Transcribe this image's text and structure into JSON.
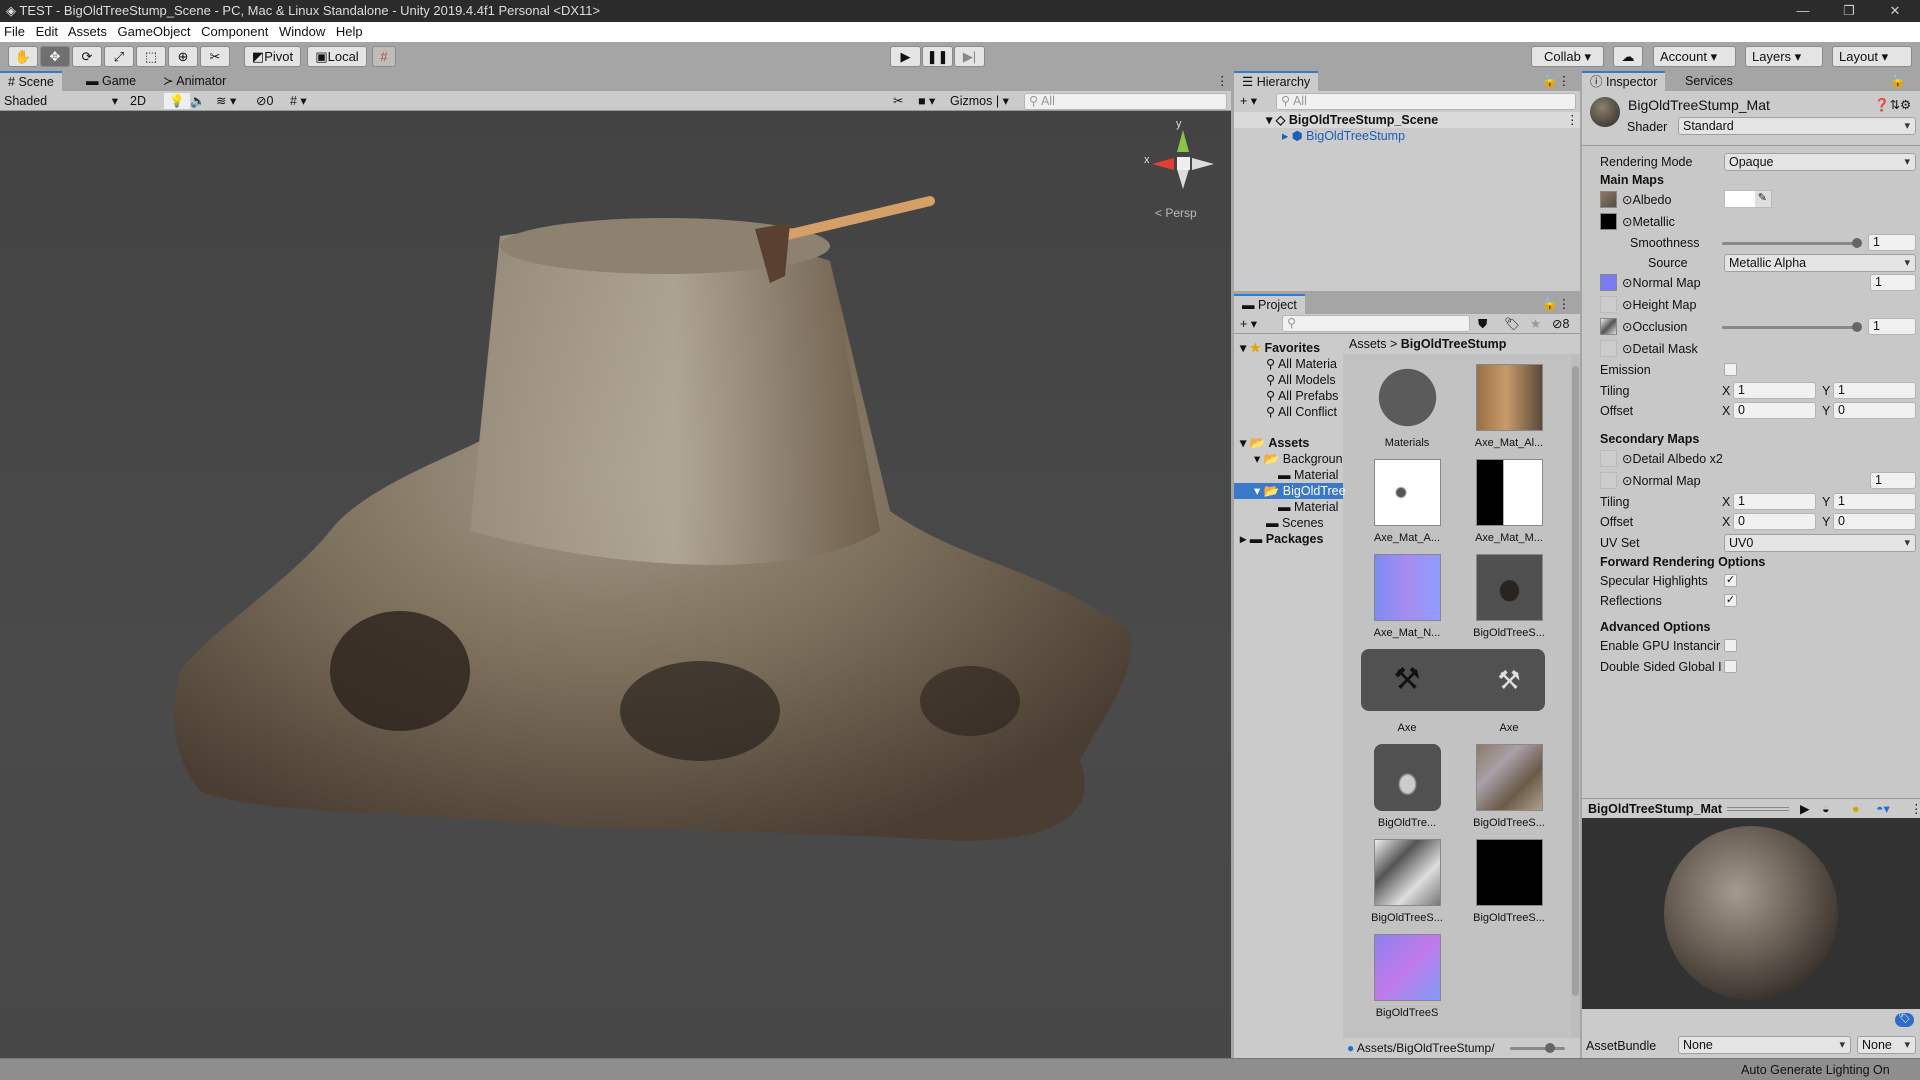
{
  "window": {
    "title": "TEST - BigOldTreeStump_Scene - PC, Mac & Linux Standalone - Unity 2019.4.4f1 Personal <DX11>",
    "minimize": "—",
    "maximize": "❐",
    "close": "✕"
  },
  "menu": [
    "File",
    "Edit",
    "Assets",
    "GameObject",
    "Component",
    "Window",
    "Help"
  ],
  "toolbar": {
    "pivot": "Pivot",
    "local": "Local",
    "collab": "Collab ▾",
    "account": "Account",
    "layers": "Layers",
    "layout": "Layout"
  },
  "scene": {
    "tabs": [
      "Scene",
      "Game",
      "Animator"
    ],
    "shading": "Shaded",
    "mode_2d": "2D",
    "hidden_count": "0",
    "gizmos": "Gizmos",
    "search_placeholder": "All",
    "axis_y": "y",
    "axis_x": "x",
    "persp": "< Persp"
  },
  "hierarchy": {
    "tab": "Hierarchy",
    "search_placeholder": "All",
    "scene": "BigOldTreeStump_Scene",
    "object": "BigOldTreeStump"
  },
  "project": {
    "tab": "Project",
    "hidden_count": "8",
    "favorites": "Favorites",
    "fav_items": [
      "All Materia",
      "All Models",
      "All Prefabs",
      "All Conflict"
    ],
    "assets": "Assets",
    "tree": [
      "Backgroun",
      "Material",
      "BigOldTree",
      "Material",
      "Scenes"
    ],
    "packages": "Packages",
    "breadcrumb": [
      "Assets",
      "BigOldTreeStump"
    ],
    "items": [
      "Materials",
      "Axe_Mat_Al...",
      "Axe_Mat_A...",
      "Axe_Mat_M...",
      "Axe_Mat_N...",
      "BigOldTreeS...",
      "Axe",
      "Axe",
      "BigOldTre...",
      "BigOldTreeS...",
      "BigOldTreeS...",
      "BigOldTreeS...",
      "BigOldTreeS"
    ],
    "path": "Assets/BigOldTreeStump/"
  },
  "inspector": {
    "tabs": [
      "Inspector",
      "Services"
    ],
    "material": "BigOldTreeStump_Mat",
    "shader_label": "Shader",
    "shader": "Standard",
    "rendering_mode_label": "Rendering Mode",
    "rendering_mode": "Opaque",
    "main_maps": "Main Maps",
    "albedo": "Albedo",
    "metallic": "Metallic",
    "smoothness": "Smoothness",
    "smoothness_value": "1",
    "source_label": "Source",
    "source": "Metallic Alpha",
    "normal_map": "Normal Map",
    "normal_value": "1",
    "height_map": "Height Map",
    "occlusion": "Occlusion",
    "occlusion_value": "1",
    "detail_mask": "Detail Mask",
    "emission": "Emission",
    "tiling": "Tiling",
    "offset": "Offset",
    "x": "X",
    "y": "Y",
    "tiling_x": "1",
    "tiling_y": "1",
    "offset_x": "0",
    "offset_y": "0",
    "secondary_maps": "Secondary Maps",
    "detail_albedo": "Detail Albedo x2",
    "normal_map2": "Normal Map",
    "normal2_value": "1",
    "tiling2_x": "1",
    "tiling2_y": "1",
    "offset2_x": "0",
    "offset2_y": "0",
    "uv_set_label": "UV Set",
    "uv_set": "UV0",
    "forward": "Forward Rendering Options",
    "specular": "Specular Highlights",
    "reflections": "Reflections",
    "advanced": "Advanced Options",
    "gpu": "Enable GPU Instancir",
    "double_sided": "Double Sided Global I",
    "specular_checked": true,
    "reflections_checked": true,
    "preview_title": "BigOldTreeStump_Mat",
    "assetbundle_label": "AssetBundle",
    "assetbundle": "None",
    "variant": "None"
  },
  "status": {
    "text": "Auto Generate Lighting On"
  }
}
